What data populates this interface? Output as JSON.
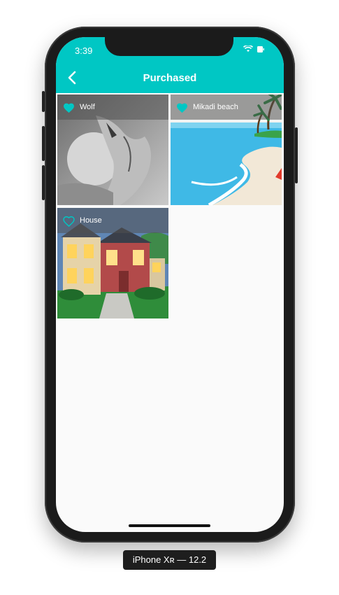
{
  "status_bar": {
    "time": "3:39"
  },
  "app_bar": {
    "title": "Purchased",
    "back_icon": "chevron-left-icon"
  },
  "items": [
    {
      "name": "Wolf",
      "favorited": true
    },
    {
      "name": "Mikadi beach",
      "favorited": true
    },
    {
      "name": "House",
      "favorited": false
    }
  ],
  "device_caption": "iPhone Xʀ — 12.2",
  "colors": {
    "accent": "#00c7c4",
    "background": "#fafafa"
  }
}
